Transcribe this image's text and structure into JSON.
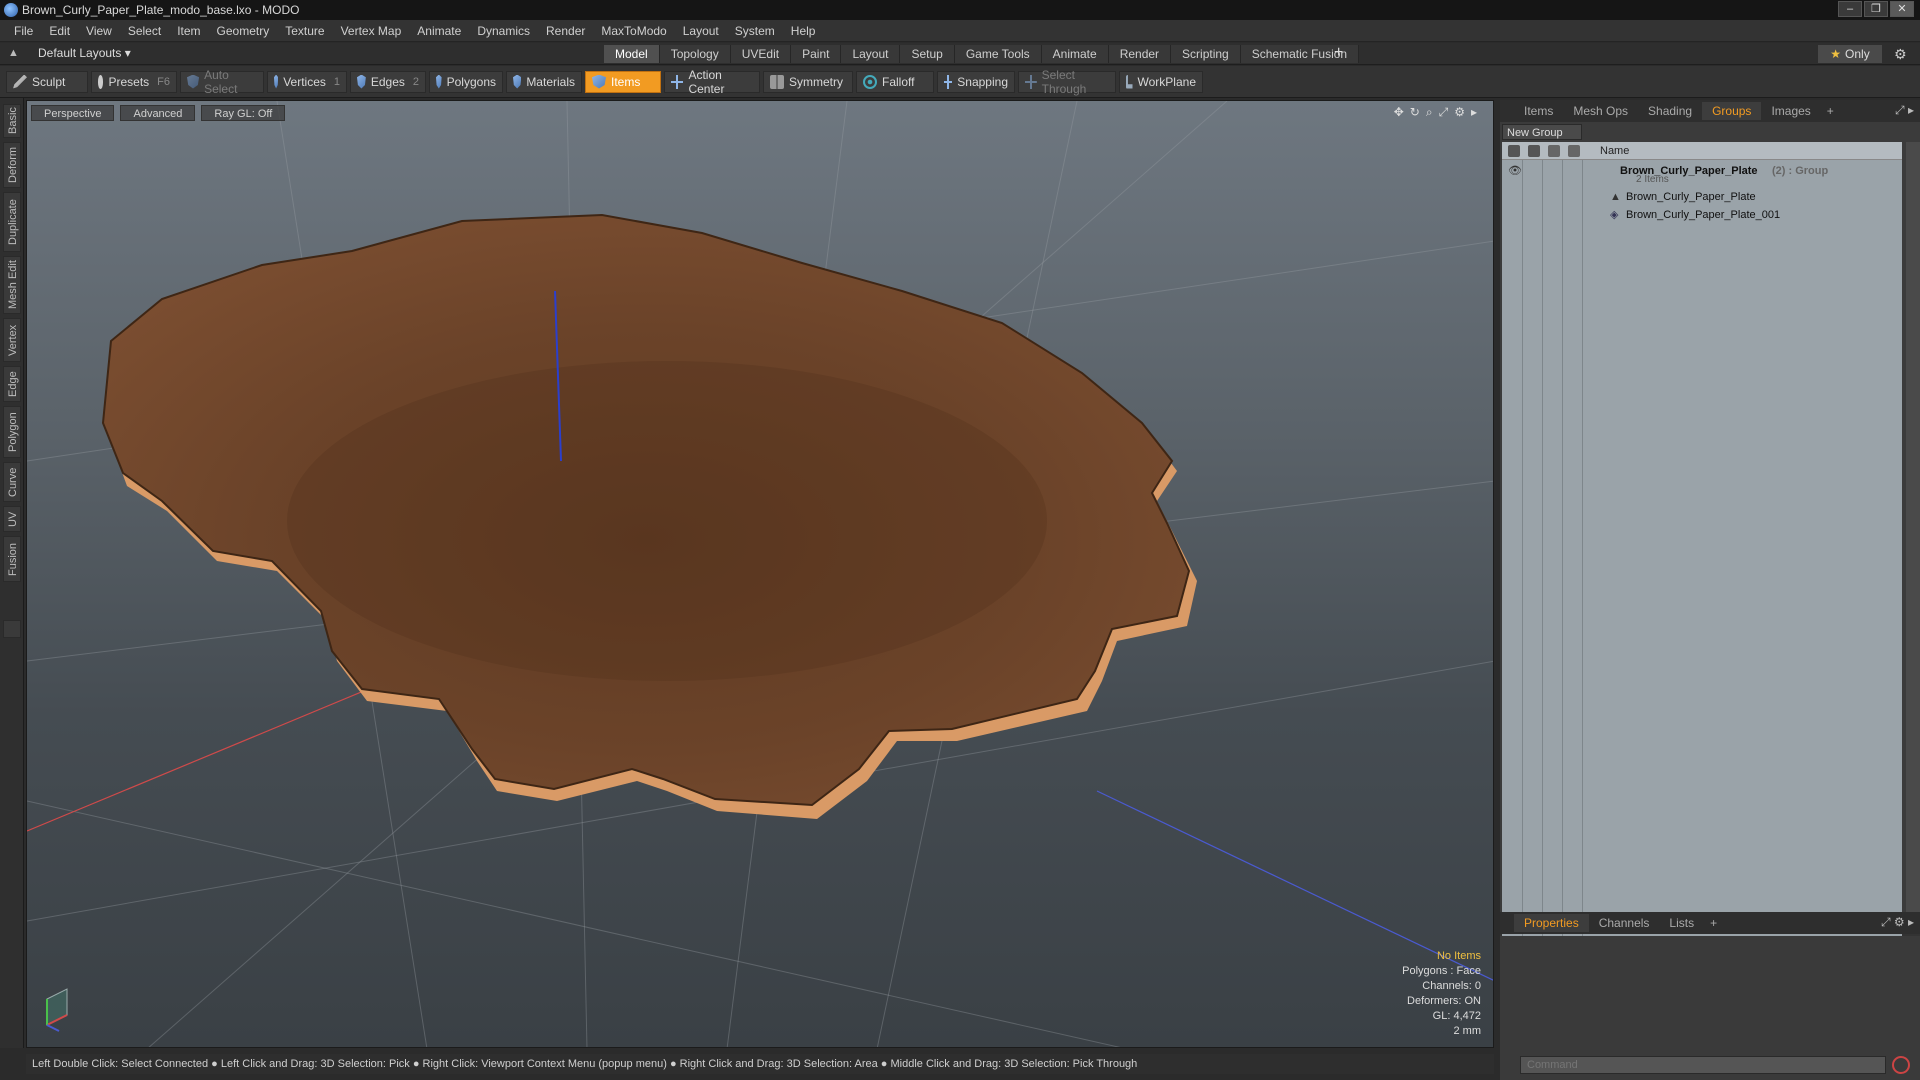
{
  "window": {
    "title": "Brown_Curly_Paper_Plate_modo_base.lxo - MODO",
    "buttons": [
      "–",
      "❐",
      "✕"
    ]
  },
  "menu": [
    "File",
    "Edit",
    "View",
    "Select",
    "Item",
    "Geometry",
    "Texture",
    "Vertex Map",
    "Animate",
    "Dynamics",
    "Render",
    "MaxToModo",
    "Layout",
    "System",
    "Help"
  ],
  "layout_bar": {
    "layout_name": "Default Layouts ▾",
    "tabs": [
      "Model",
      "Topology",
      "UVEdit",
      "Paint",
      "Layout",
      "Setup",
      "Game Tools",
      "Animate",
      "Render",
      "Scripting",
      "Schematic Fusion"
    ],
    "active_tab": "Model",
    "add": "+",
    "only_label": "Only",
    "only_star": "★"
  },
  "toolbar": {
    "sculpt": "Sculpt",
    "presets": "Presets",
    "presets_key": "F6",
    "auto_select": "Auto Select",
    "vertices": "Vertices",
    "vertices_key": "1",
    "edges": "Edges",
    "edges_key": "2",
    "polygons": "Polygons",
    "materials": "Materials",
    "items": "Items",
    "action_center": "Action Center",
    "symmetry": "Symmetry",
    "falloff": "Falloff",
    "snapping": "Snapping",
    "select_through": "Select Through",
    "workplane": "WorkPlane"
  },
  "left_tabs": [
    "Basic",
    "Deform",
    "Duplicate",
    "Mesh Edit",
    "Vertex",
    "Edge",
    "Polygon",
    "Curve",
    "UV",
    "Fusion"
  ],
  "viewport": {
    "view": "Perspective",
    "shading": "Advanced",
    "raygl": "Ray GL: Off",
    "stats": {
      "selection": "No Items",
      "polygons": "Polygons : Face",
      "channels": "Channels: 0",
      "deformers": "Deformers: ON",
      "gl": "GL: 4,472",
      "scale": "2 mm"
    },
    "colors": {
      "plate_top": "#6b4329",
      "plate_rim": "#d99a66",
      "grid": "#9aa0a5"
    }
  },
  "status_bar": "Left Double Click: Select Connected ● Left Click and Drag: 3D Selection: Pick ● Right Click: Viewport Context Menu (popup menu) ● Right Click and Drag: 3D Selection: Area ● Middle Click and Drag: 3D Selection: Pick Through",
  "right_panel": {
    "top_tabs": [
      "Items",
      "Mesh Ops",
      "Shading",
      "Groups",
      "Images"
    ],
    "top_active": "Groups",
    "new_group": "New Group",
    "column_name": "Name",
    "group": {
      "name": "Brown_Curly_Paper_Plate",
      "suffix": "(2) : Group",
      "count": "2 Items",
      "children": [
        "Brown_Curly_Paper_Plate",
        "Brown_Curly_Paper_Plate_001"
      ]
    },
    "bottom_tabs": [
      "Properties",
      "Channels",
      "Lists"
    ],
    "bottom_active": "Properties",
    "command_placeholder": "Command"
  }
}
